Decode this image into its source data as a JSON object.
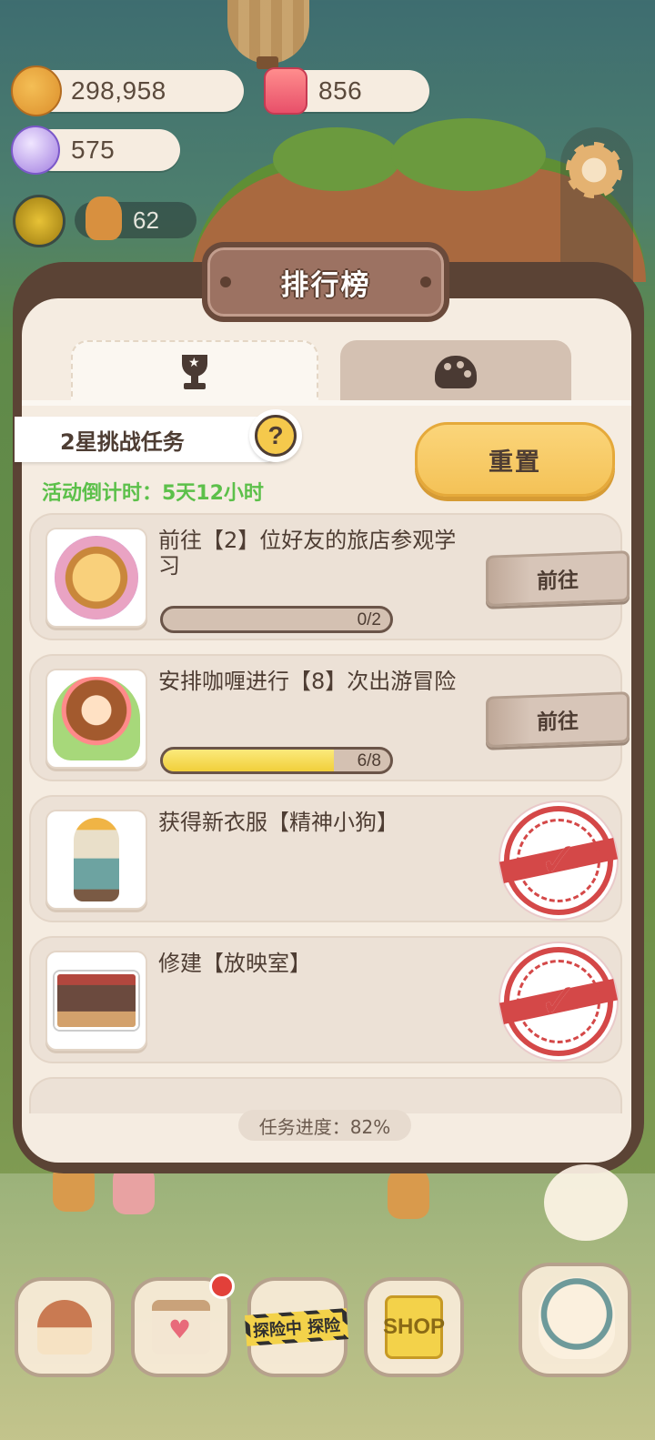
{
  "currencies": {
    "cookies": "298,958",
    "jam": "856",
    "gems": "575",
    "gingerbread": "62"
  },
  "panel": {
    "title": "排行榜",
    "tabs": [
      {
        "icon": "trophy-icon",
        "active": true
      },
      {
        "icon": "cookie-icon",
        "active": false
      }
    ],
    "challenge_title": "2星挑战任务",
    "help_label": "?",
    "countdown": "活动倒计时：5天12小时",
    "reset_label": "重置",
    "tasks": [
      {
        "title": "前往【2】位好友的旅店参观学习",
        "progress_text": "0/2",
        "progress_fraction": 0.0,
        "action_label": "前往",
        "done": false
      },
      {
        "title": "安排咖喱进行【8】次出游冒险",
        "progress_text": "6/8",
        "progress_fraction": 0.75,
        "action_label": "前往",
        "done": false
      },
      {
        "title": "获得新衣服【精神小狗】",
        "done": true
      },
      {
        "title": "修建【放映室】",
        "done": true
      }
    ],
    "total_progress": "任务进度：82%"
  },
  "dock": {
    "adventure_label": "探险中 探险",
    "shop_label": "SHOP"
  },
  "colors": {
    "accent_yellow": "#f4c257",
    "countdown_green": "#5cc04a",
    "stamp_red": "#d44848",
    "panel_bg": "#f5ece1"
  }
}
